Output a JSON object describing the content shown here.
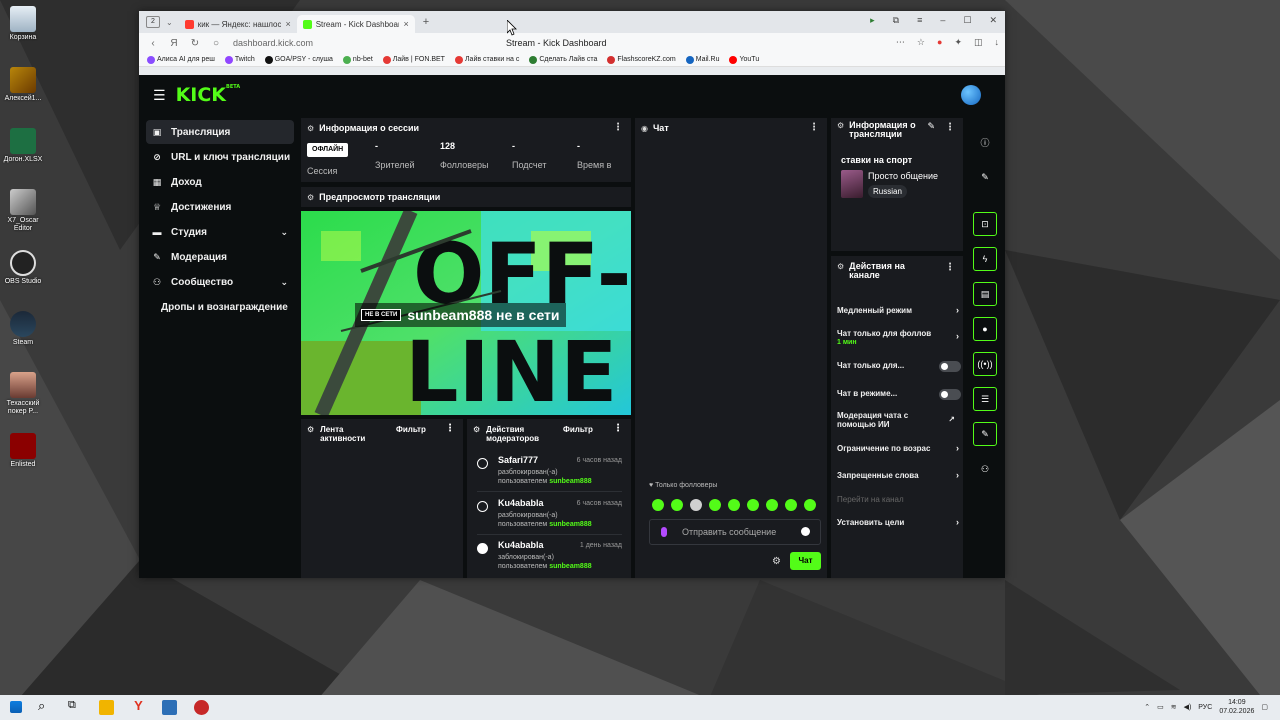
{
  "desktop": {
    "icons": [
      {
        "label": "Корзина"
      },
      {
        "label": "Алексей1..."
      },
      {
        "label": "Догон.XLSX"
      },
      {
        "label": "X7_Oscar Editor"
      },
      {
        "label": "OBS Studio"
      },
      {
        "label": "Steam"
      },
      {
        "label": "Техасский покер P..."
      },
      {
        "label": "Enlisted"
      }
    ]
  },
  "browser": {
    "tab_count": "2",
    "tabs": [
      {
        "label": "кик — Яндекс: нашлось 2!",
        "favicon_color": "#ff3b30"
      },
      {
        "label": "Stream - Kick Dashboard",
        "favicon_color": "#53fc18"
      }
    ],
    "url": "dashboard.kick.com",
    "page_title": "Stream - Kick Dashboard",
    "bookmarks": [
      {
        "label": "Алиса AI для реш",
        "color": "#8a4dff"
      },
      {
        "label": "Twitch",
        "color": "#9146ff"
      },
      {
        "label": "GOA/PSY - слуша",
        "color": "#111111"
      },
      {
        "label": "nb-bet",
        "color": "#4caf50"
      },
      {
        "label": "Лайв | FON.BET",
        "color": "#e53935"
      },
      {
        "label": "Лайв ставки на с",
        "color": "#e53935"
      },
      {
        "label": "Сделать Лайв ста",
        "color": "#2e7d32"
      },
      {
        "label": "FlashscoreKZ.com",
        "color": "#d32f2f"
      },
      {
        "label": "Mail.Ru",
        "color": "#1565c0"
      },
      {
        "label": "YouTu",
        "color": "#ff0000"
      }
    ]
  },
  "kick": {
    "logo": "KICK",
    "logo_badge": "BETA",
    "sidebar": {
      "items": [
        {
          "label": "Трансляция",
          "icon": "broadcast-icon"
        },
        {
          "label": "URL и ключ трансляции",
          "icon": "key-icon"
        },
        {
          "label": "Доход",
          "icon": "chart-icon"
        },
        {
          "label": "Достижения",
          "icon": "trophy-icon"
        },
        {
          "label": "Студия",
          "icon": "studio-icon"
        },
        {
          "label": "Модерация",
          "icon": "wrench-icon"
        },
        {
          "label": "Сообщество",
          "icon": "community-icon"
        }
      ],
      "sub_item": "Дропы и вознаграждение"
    },
    "session": {
      "title": "Информация о сессии",
      "status": "ОФЛАЙН",
      "session_label": "Сессия",
      "stats": [
        {
          "value": "-",
          "label": "Зрителей"
        },
        {
          "value": "128",
          "label": "Фолловеры"
        },
        {
          "value": "-",
          "label": "Подсчет"
        },
        {
          "value": "-",
          "label": "Время в"
        }
      ]
    },
    "preview": {
      "title": "Предпросмотр трансляции",
      "badge": "НЕ В СЕТИ",
      "message": "sunbeam888 не в сети",
      "bg_text_top": "OFF-",
      "bg_text_bottom": "LINE"
    },
    "activity": {
      "title": "Лента активности",
      "filter": "Фильтр"
    },
    "mod_actions": {
      "title": "Действия модераторов",
      "filter": "Фильтр",
      "entries": [
        {
          "name": "Safari777",
          "time": "6 часов назад",
          "action": "разблокирован(-а)",
          "by_prefix": "пользователем",
          "by": "sunbeam888"
        },
        {
          "name": "Ku4ababla",
          "time": "6 часов назад",
          "action": "разблокирован(-а)",
          "by_prefix": "пользователем",
          "by": "sunbeam888"
        },
        {
          "name": "Ku4ababla",
          "time": "1 день назад",
          "action": "заблокирован(-а)",
          "by_prefix": "пользователем",
          "by": "sunbeam888"
        }
      ]
    },
    "chat": {
      "title": "Чат",
      "followers_only": "Только фолловеры",
      "placeholder": "Отправить сообщение",
      "send": "Чат"
    },
    "stream_info": {
      "title": "Информация о трансляции",
      "stream_title": "ставки на спорт",
      "category": "Просто общение",
      "tag": "Russian"
    },
    "channel_actions": {
      "title": "Действия на канале",
      "items": [
        {
          "label": "Медленный режим"
        },
        {
          "label": "Чат только для фоллов",
          "sub": "1 мин"
        },
        {
          "label": "Чат только для..."
        },
        {
          "label": "Чат в режиме..."
        },
        {
          "label": "Модерация чата с помощью ИИ"
        },
        {
          "label": "Ограничение по возрас"
        },
        {
          "label": "Запрещенные слова"
        },
        {
          "label": "Перейти на канал"
        },
        {
          "label": "Установить цели"
        }
      ]
    }
  },
  "taskbar": {
    "language": "РУС",
    "time": "14:09",
    "date": "07.02.2026"
  }
}
